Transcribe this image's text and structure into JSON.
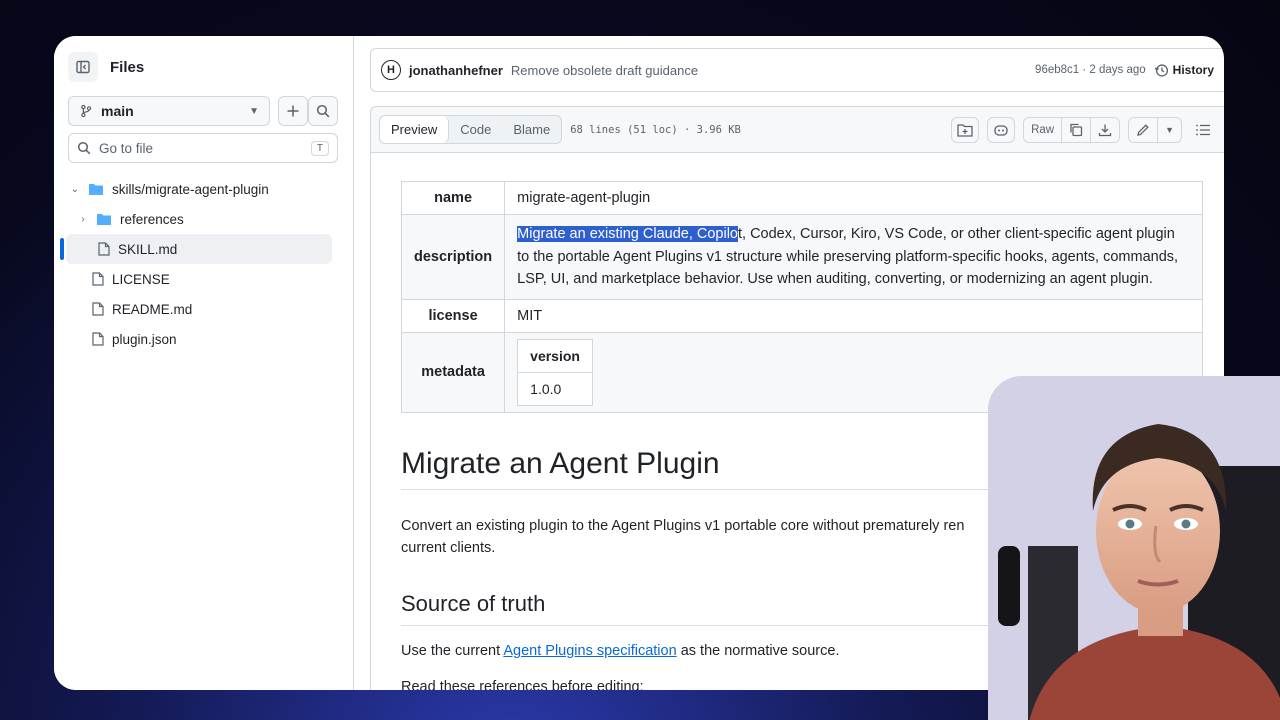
{
  "sidebar": {
    "title": "Files",
    "branch": "main",
    "goto_placeholder": "Go to file",
    "goto_key": "T",
    "tree": [
      {
        "label": "skills/migrate-agent-plugin",
        "type": "folder",
        "expanded": true
      },
      {
        "label": "references",
        "type": "folder",
        "expanded": false
      },
      {
        "label": "SKILL.md",
        "type": "file",
        "selected": true
      },
      {
        "label": "LICENSE",
        "type": "file"
      },
      {
        "label": "README.md",
        "type": "file"
      },
      {
        "label": "plugin.json",
        "type": "file"
      }
    ]
  },
  "commit": {
    "author": "jonathanhefner",
    "message": "Remove obsolete draft guidance",
    "sha_time": "96eb8c1 · 2 days ago",
    "history_label": "History"
  },
  "file_header": {
    "tabs": [
      "Preview",
      "Code",
      "Blame"
    ],
    "active_tab": "Preview",
    "info": "68 lines (51 loc) · 3.96 KB",
    "raw_label": "Raw"
  },
  "frontmatter": {
    "name_key": "name",
    "name_val": "migrate-agent-plugin",
    "desc_key": "description",
    "desc_highlight": "Migrate an existing Claude, Copilo",
    "desc_rest": "t, Codex, Cursor, Kiro, VS Code, or other client-specific agent plugin to the portable Agent Plugins v1 structure while preserving platform-specific hooks, agents, commands, LSP, UI, and marketplace behavior. Use when auditing, converting, or modernizing an agent plugin.",
    "license_key": "license",
    "license_val": "MIT",
    "metadata_key": "metadata",
    "version_key": "version",
    "version_val": "1.0.0"
  },
  "content": {
    "h1": "Migrate an Agent Plugin",
    "p1_line1": "Convert an existing plugin to the Agent Plugins v1 portable core without prematurely ren",
    "p1_line2": "current clients.",
    "h2": "Source of truth",
    "p2_before": "Use the current ",
    "p2_link": "Agent Plugins specification",
    "p2_after": " as the normative source.",
    "p3": "Read these references before editing:"
  },
  "colors": {
    "accent": "#0969da",
    "highlight": "#2e5fce",
    "border": "#d0d7de"
  }
}
